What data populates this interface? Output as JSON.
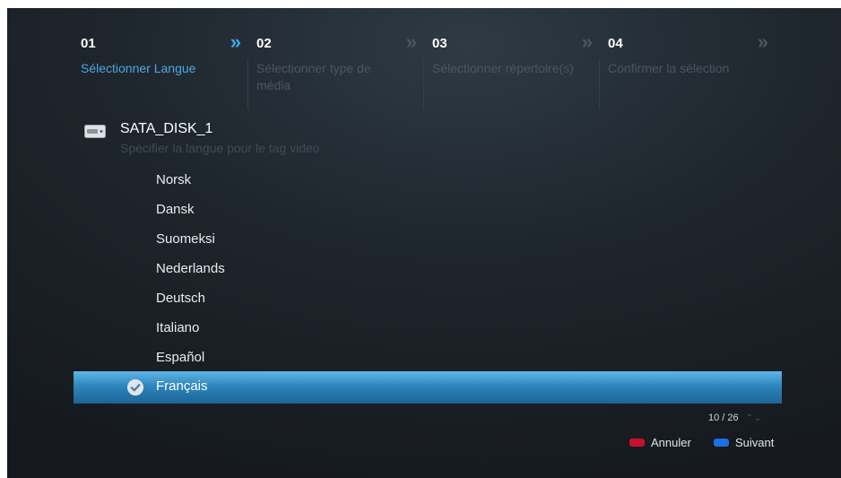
{
  "wizard": {
    "steps": [
      {
        "num": "01",
        "label": "Sélectionner Langue",
        "arrow": "»"
      },
      {
        "num": "02",
        "label": "Sélectionner type de média",
        "arrow": "»"
      },
      {
        "num": "03",
        "label": "Sélectionner répertoire(s)",
        "arrow": "»"
      },
      {
        "num": "04",
        "label": "Confirmer la sélection",
        "arrow": "»"
      }
    ],
    "active_index": 0
  },
  "device": {
    "name": "SATA_DISK_1",
    "description": "Spécifier la langue pour le tag video",
    "icon": "hard-drive-icon"
  },
  "languages": {
    "items": [
      "Norsk",
      "Dansk",
      "Suomeksi",
      "Nederlands",
      "Deutsch",
      "Italiano",
      "Español",
      "Français"
    ],
    "selected_index": 7
  },
  "pager": {
    "text": "10 / 26",
    "arrows": "⌃⌄"
  },
  "footer": {
    "cancel_label": "Annuler",
    "next_label": "Suivant",
    "cancel_color": "#c8102e",
    "next_color": "#1e6fe0"
  },
  "colors": {
    "accent": "#3aa8e8",
    "highlight_top": "#5fb6e6",
    "highlight_bottom": "#1d6497"
  }
}
